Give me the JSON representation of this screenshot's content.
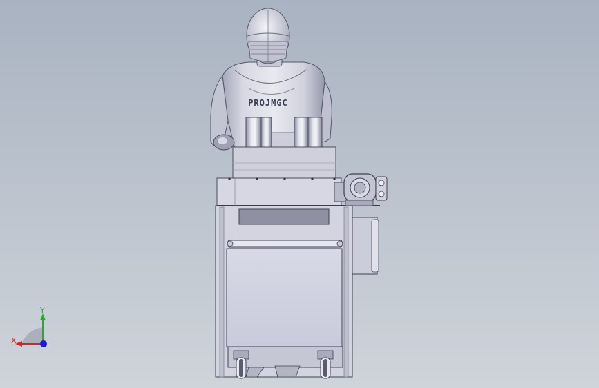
{
  "viewport": {
    "background_top": "#a9b3c1",
    "background_bottom": "#cfd4da"
  },
  "model": {
    "figure_chest_text": "PRQJMGC"
  },
  "triad": {
    "x_label": "X",
    "y_label": "Y",
    "x_color": "#e02020",
    "y_color": "#20b020",
    "z_color": "#1a1ae0"
  }
}
